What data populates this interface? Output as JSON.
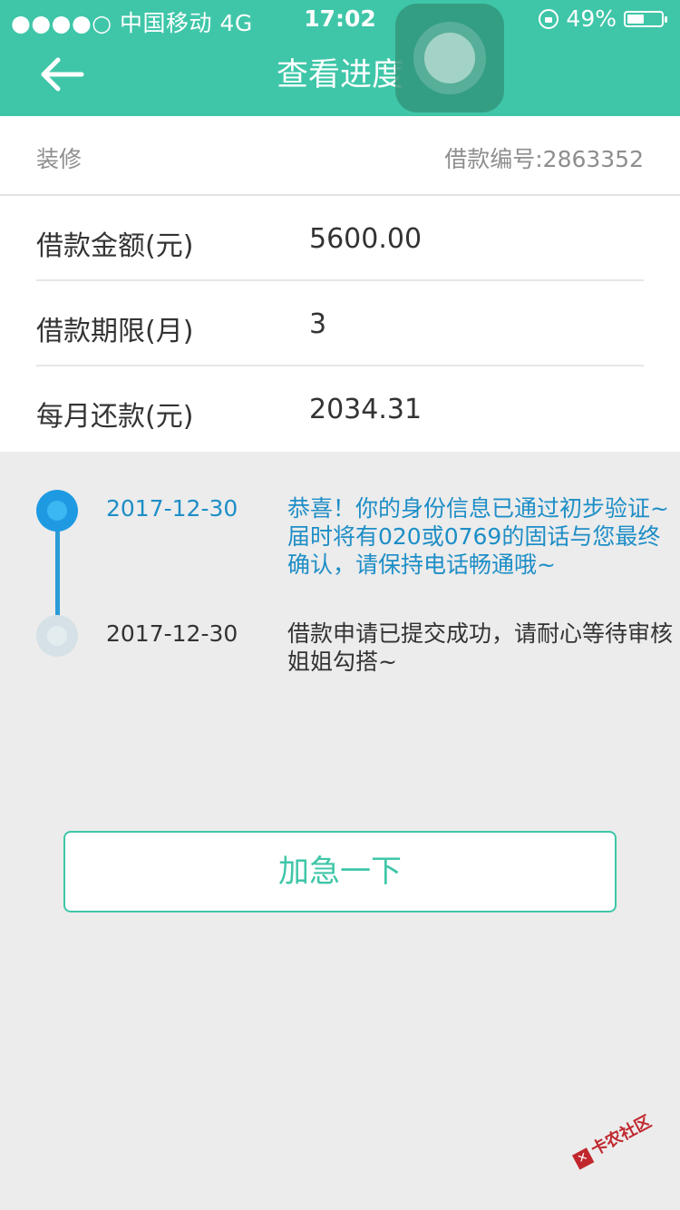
{
  "status_bar": {
    "carrier": "●●●●○ 中国移动  4G",
    "time": "17:02",
    "battery": "49%",
    "battery_level": 0.49
  },
  "header": {
    "title": "查看进度"
  },
  "info": {
    "purpose": "装修",
    "loan_number": "借款编号:2863352"
  },
  "details": [
    {
      "label": "借款金额(元)",
      "value": "5600.00"
    },
    {
      "label": "借款期限(月)",
      "value": "3"
    },
    {
      "label": "每月还款(元)",
      "value": "2034.31"
    }
  ],
  "timeline": [
    {
      "date": "2017-12-30",
      "message": "恭喜！你的身份信息已通过初步验证~届时将有020或0769的固话与您最终确认，请保持电话畅通哦~",
      "active": true
    },
    {
      "date": "2017-12-30",
      "message": "借款申请已提交成功，请耐心等待审核姐姐勾搭~",
      "active": false
    }
  ],
  "actions": {
    "urge_label": "加急一下"
  },
  "watermark": {
    "text": "卡农社区"
  },
  "colors": {
    "primary": "#3fc6a8",
    "timeline_active": "#1e9ae3",
    "background": "#ececec"
  }
}
